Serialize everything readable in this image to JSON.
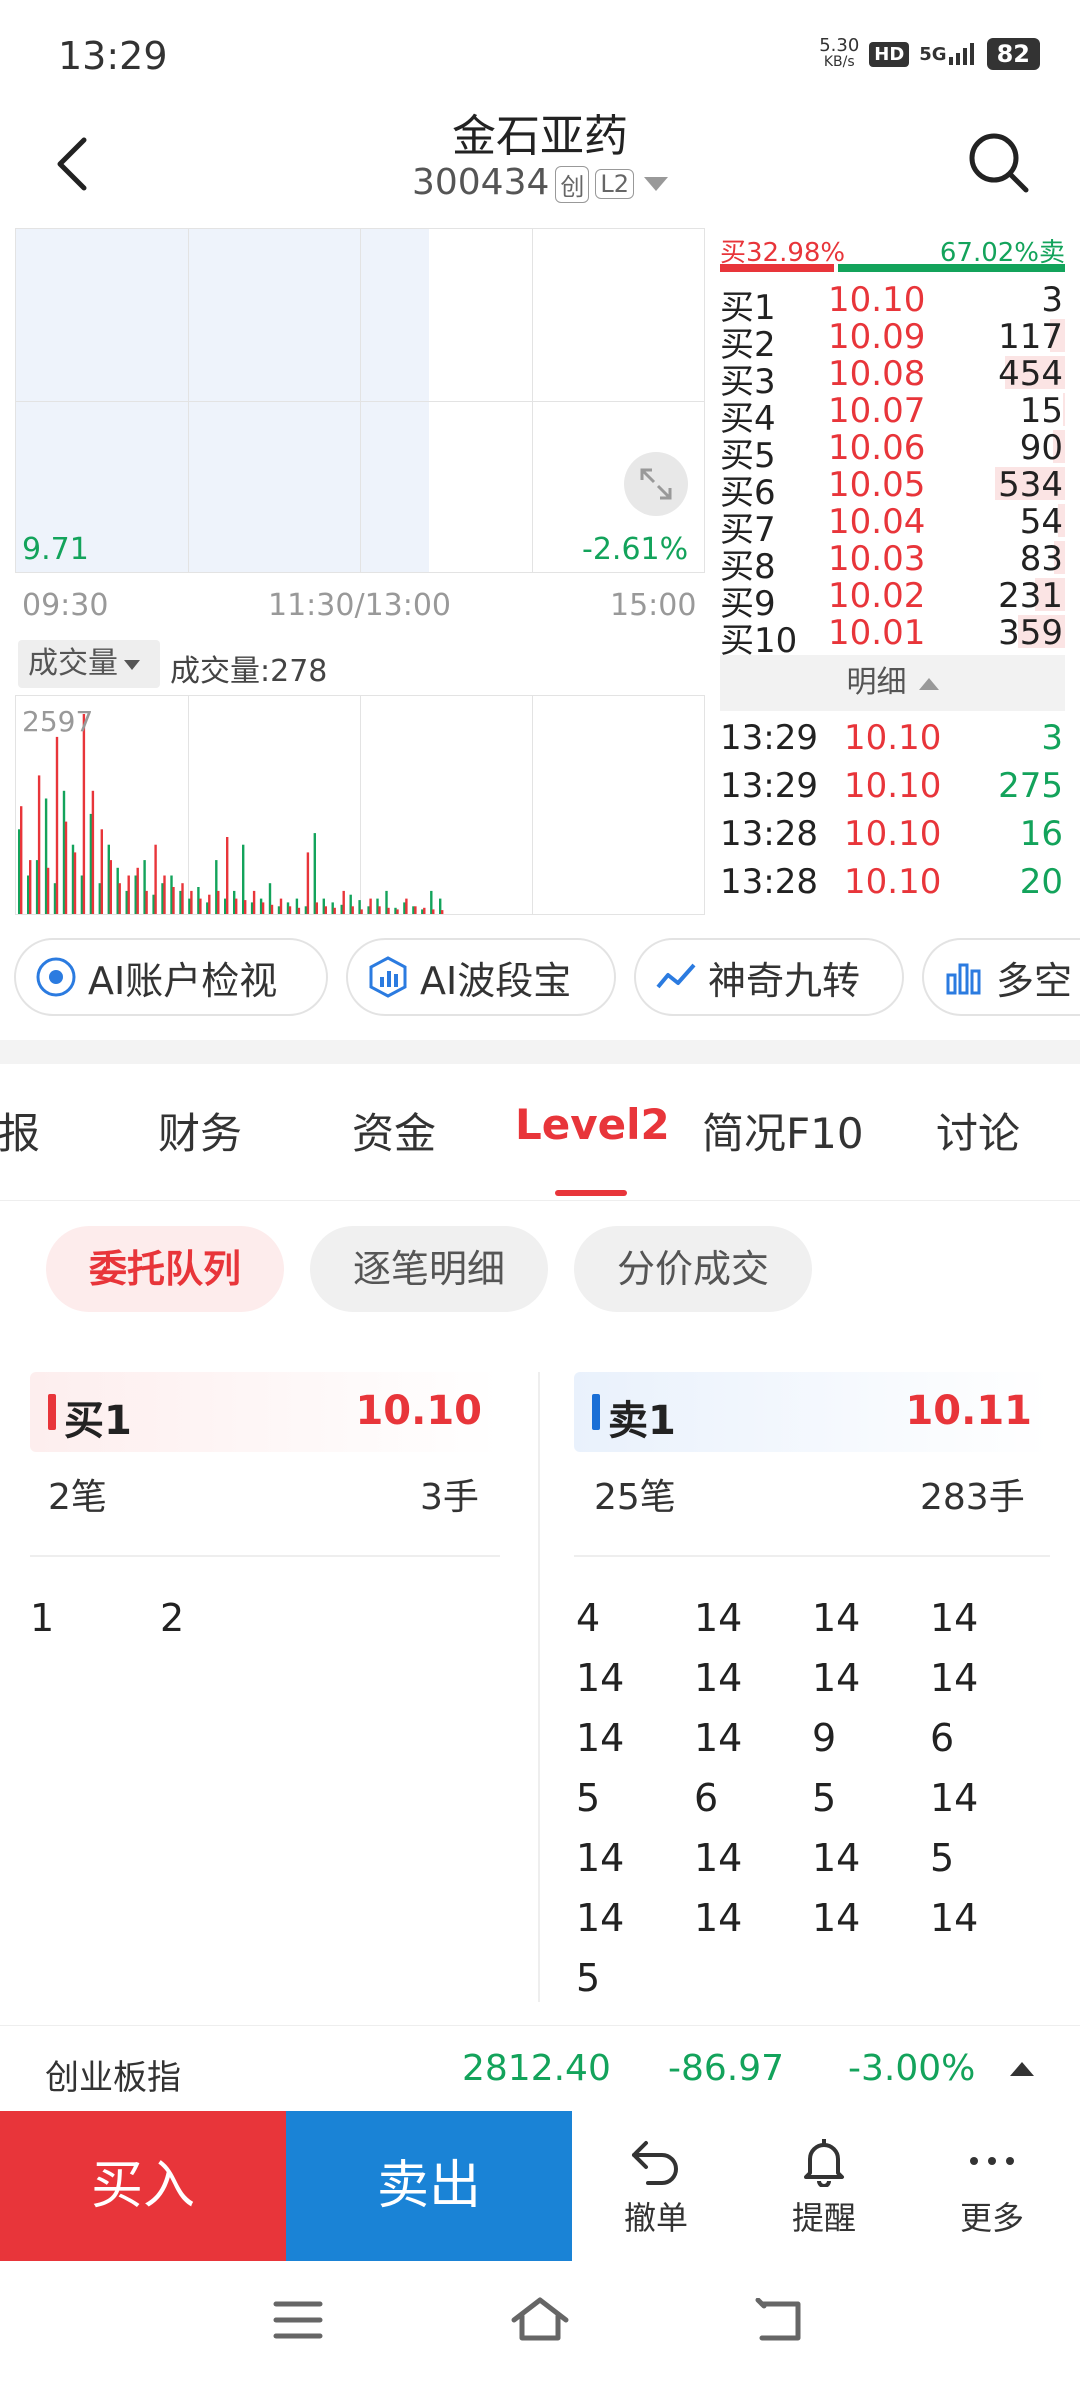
{
  "status": {
    "time": "13:29",
    "net_speed": "5.30",
    "net_unit": "KB/s",
    "hd": "HD",
    "signal": "5G",
    "battery": "82"
  },
  "header": {
    "title": "金石亚药",
    "code": "300434",
    "tag_chuang": "创",
    "tag_l2": "L2"
  },
  "chart": {
    "low_price": "9.71",
    "low_pct": "-2.61%",
    "time_start": "09:30",
    "time_mid": "11:30/13:00",
    "time_end": "15:00",
    "vol_selector": "成交量",
    "vol_label": "成交量:278",
    "vol_max": "2597"
  },
  "chart_data": {
    "type": "bar",
    "title": "成交量",
    "ylim": [
      0,
      2597
    ],
    "red_values": [
      1400,
      700,
      1800,
      600,
      2300,
      1200,
      800,
      2597,
      1600,
      1100,
      700,
      400,
      500,
      600,
      300,
      900,
      500,
      350,
      400,
      300,
      200,
      250,
      300,
      1000,
      200,
      180,
      300,
      150,
      120,
      200,
      100,
      80,
      800,
      150,
      100,
      80,
      300,
      100,
      60,
      200,
      100,
      80,
      60,
      200,
      100,
      80,
      60,
      50
    ],
    "green_values": [
      1100,
      500,
      700,
      1500,
      400,
      1600,
      900,
      500,
      1300,
      400,
      900,
      600,
      300,
      500,
      700,
      250,
      400,
      500,
      300,
      200,
      350,
      150,
      700,
      200,
      300,
      900,
      150,
      200,
      400,
      100,
      150,
      200,
      100,
      1050,
      200,
      150,
      120,
      250,
      180,
      100,
      200,
      300,
      80,
      150,
      100,
      60,
      300,
      200
    ]
  },
  "order_book": {
    "buy_ratio": "买32.98%",
    "sell_ratio": "67.02%卖",
    "buy_ratio_value": 32.98,
    "rows": [
      {
        "label": "买1",
        "price": "10.10",
        "vol": "3",
        "vol_value": 3
      },
      {
        "label": "买2",
        "price": "10.09",
        "vol": "117",
        "vol_value": 117
      },
      {
        "label": "买3",
        "price": "10.08",
        "vol": "454",
        "vol_value": 454
      },
      {
        "label": "买4",
        "price": "10.07",
        "vol": "15",
        "vol_value": 15
      },
      {
        "label": "买5",
        "price": "10.06",
        "vol": "90",
        "vol_value": 90
      },
      {
        "label": "买6",
        "price": "10.05",
        "vol": "534",
        "vol_value": 534
      },
      {
        "label": "买7",
        "price": "10.04",
        "vol": "54",
        "vol_value": 54
      },
      {
        "label": "买8",
        "price": "10.03",
        "vol": "83",
        "vol_value": 83
      },
      {
        "label": "买9",
        "price": "10.02",
        "vol": "231",
        "vol_value": 231
      },
      {
        "label": "买10",
        "price": "10.01",
        "vol": "359",
        "vol_value": 359
      }
    ],
    "detail_label": "明细",
    "ticks": [
      {
        "time": "13:29",
        "price": "10.10",
        "vol": "3"
      },
      {
        "time": "13:29",
        "price": "10.10",
        "vol": "275"
      },
      {
        "time": "13:28",
        "price": "10.10",
        "vol": "16"
      },
      {
        "time": "13:28",
        "price": "10.10",
        "vol": "20"
      }
    ]
  },
  "tools": [
    "AI账户检视",
    "AI波段宝",
    "神奇九转",
    "多空"
  ],
  "tabs": [
    "季报",
    "财务",
    "资金",
    "Level2",
    "简况F10",
    "讨论"
  ],
  "subtabs": [
    "委托队列",
    "逐笔明细",
    "分价成交"
  ],
  "queue": {
    "buy": {
      "label": "买1",
      "price": "10.10",
      "count": "2笔",
      "volume": "3手",
      "items": [
        "1",
        "2"
      ]
    },
    "sell": {
      "label": "卖1",
      "price": "10.11",
      "count": "25笔",
      "volume": "283手",
      "items": [
        "4",
        "14",
        "14",
        "14",
        "14",
        "14",
        "14",
        "14",
        "14",
        "14",
        "9",
        "6",
        "5",
        "6",
        "5",
        "14",
        "14",
        "14",
        "14",
        "5",
        "14",
        "14",
        "14",
        "14",
        "5"
      ]
    }
  },
  "index": {
    "name": "创业板指",
    "value": "2812.40",
    "change": "-86.97",
    "pct": "-3.00%"
  },
  "actions": {
    "buy": "买入",
    "sell": "卖出",
    "cancel": "撤单",
    "alert": "提醒",
    "more": "更多"
  },
  "colors": {
    "up": "#e8353a",
    "down": "#13a35b",
    "sell_button": "#1a83d6"
  }
}
